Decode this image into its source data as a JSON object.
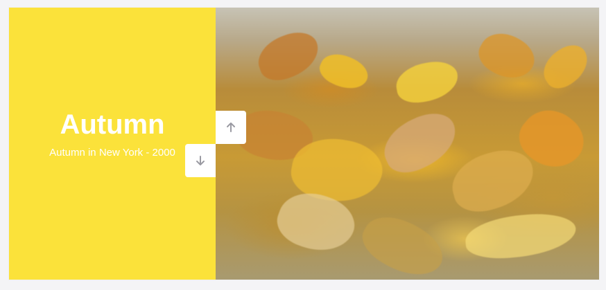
{
  "slide": {
    "title": "Autumn",
    "subtitle": "Autumn in New York - 2000"
  },
  "photo": {
    "subject": "fallen-autumn-leaves-photo"
  },
  "controls": {
    "up_icon": "arrow-up-icon",
    "down_icon": "arrow-down-icon"
  },
  "colors": {
    "panel_background": "#fbe23a",
    "text": "#ffffff",
    "button_background": "#ffffff",
    "arrow": "#9a9aa2",
    "page_background": "#f4f4f6"
  }
}
